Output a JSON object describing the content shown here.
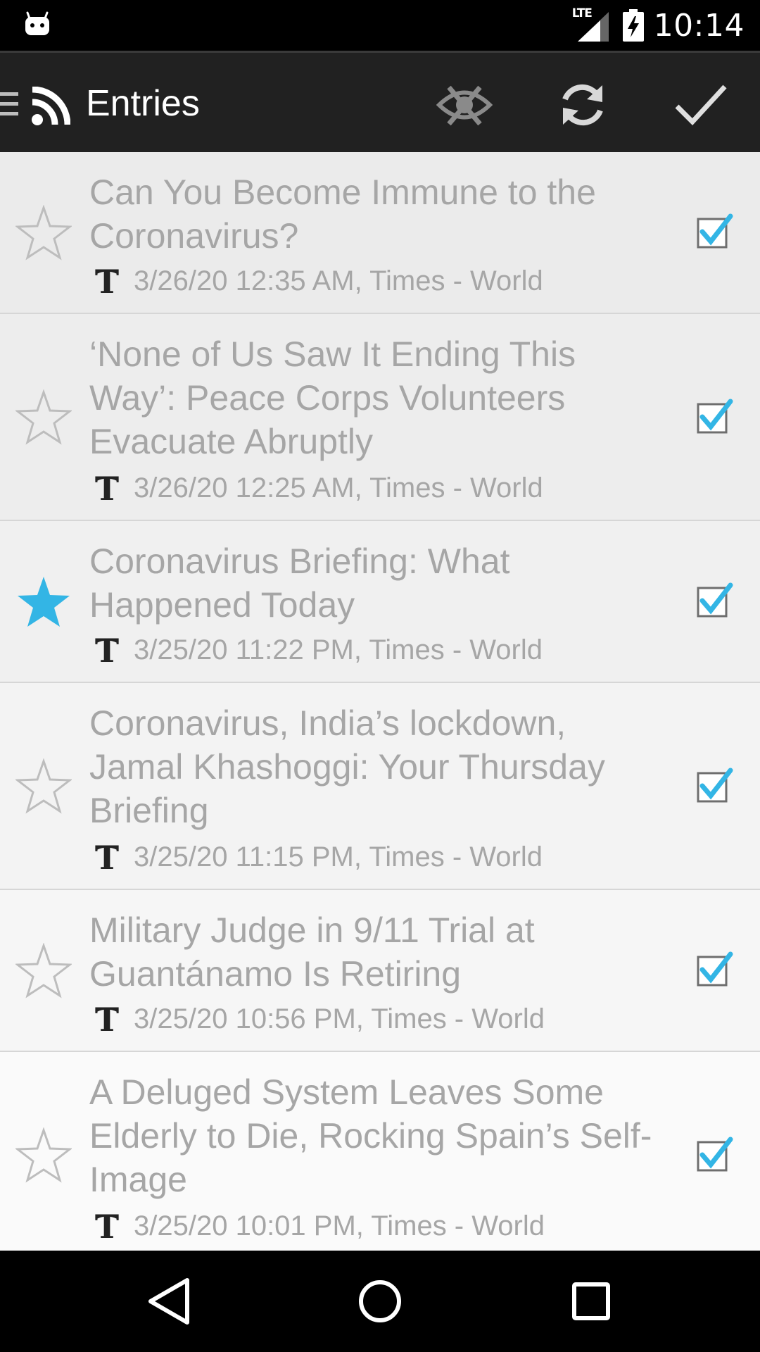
{
  "status_bar": {
    "network": "LTE",
    "time": "10:14",
    "icons": [
      "android-notification-icon",
      "lte-signal-icon",
      "battery-charging-icon"
    ]
  },
  "action_bar": {
    "title": "Entries",
    "actions": [
      "hide-read-icon",
      "refresh-icon",
      "mark-all-read-icon"
    ]
  },
  "entries": [
    {
      "title": "Can You Become Immune to the Coronavirus?",
      "meta": "3/26/20 12:35 AM, Times - World",
      "starred": false,
      "checked": true
    },
    {
      "title": "‘None of Us Saw It Ending This Way’: Peace Corps Volunteers Evacuate Abruptly",
      "meta": "3/26/20 12:25 AM, Times - World",
      "starred": false,
      "checked": true
    },
    {
      "title": "Coronavirus Briefing: What Happened Today",
      "meta": "3/25/20 11:22 PM, Times - World",
      "starred": true,
      "checked": true
    },
    {
      "title": "Coronavirus, India’s lockdown, Jamal Khashoggi: Your Thursday Briefing",
      "meta": "3/25/20 11:15 PM, Times - World",
      "starred": false,
      "checked": true
    },
    {
      "title": "Military Judge in 9/11 Trial at Guantánamo Is Retiring",
      "meta": "3/25/20 10:56 PM, Times - World",
      "starred": false,
      "checked": true
    },
    {
      "title": "A Deluged System Leaves Some Elderly to Die, Rocking Spain’s Self-Image",
      "meta": "3/25/20 10:01 PM, Times - World",
      "starred": false,
      "checked": true
    }
  ],
  "navigation_bar": {
    "buttons": [
      "back-icon",
      "home-icon",
      "recents-icon"
    ]
  },
  "colors": {
    "accent": "#33B5E5",
    "text_read": "#A6A6A6",
    "action_bar": "#212121"
  }
}
